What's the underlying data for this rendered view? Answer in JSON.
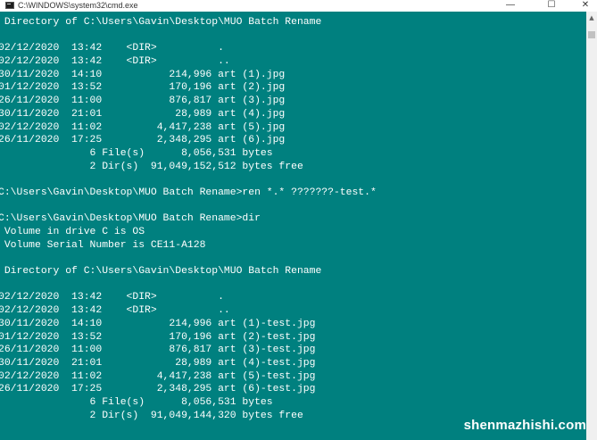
{
  "window": {
    "title": "C:\\WINDOWS\\system32\\cmd.exe",
    "minimize_glyph": "—",
    "maximize_glyph": "☐",
    "close_glyph": "✕"
  },
  "console": {
    "lines": [
      " Directory of C:\\Users\\Gavin\\Desktop\\MUO Batch Rename",
      "",
      "02/12/2020  13:42    <DIR>          .",
      "02/12/2020  13:42    <DIR>          ..",
      "30/11/2020  14:10           214,996 art (1).jpg",
      "01/12/2020  13:52           170,196 art (2).jpg",
      "26/11/2020  11:00           876,817 art (3).jpg",
      "30/11/2020  21:01            28,989 art (4).jpg",
      "02/12/2020  11:02         4,417,238 art (5).jpg",
      "26/11/2020  17:25         2,348,295 art (6).jpg",
      "               6 File(s)      8,056,531 bytes",
      "               2 Dir(s)  91,049,152,512 bytes free",
      "",
      "C:\\Users\\Gavin\\Desktop\\MUO Batch Rename>ren *.* ???????-test.*",
      "",
      "C:\\Users\\Gavin\\Desktop\\MUO Batch Rename>dir",
      " Volume in drive C is OS",
      " Volume Serial Number is CE11-A128",
      "",
      " Directory of C:\\Users\\Gavin\\Desktop\\MUO Batch Rename",
      "",
      "02/12/2020  13:42    <DIR>          .",
      "02/12/2020  13:42    <DIR>          ..",
      "30/11/2020  14:10           214,996 art (1)-test.jpg",
      "01/12/2020  13:52           170,196 art (2)-test.jpg",
      "26/11/2020  11:00           876,817 art (3)-test.jpg",
      "30/11/2020  21:01            28,989 art (4)-test.jpg",
      "02/12/2020  11:02         4,417,238 art (5)-test.jpg",
      "26/11/2020  17:25         2,348,295 art (6)-test.jpg",
      "               6 File(s)      8,056,531 bytes",
      "               2 Dir(s)  91,049,144,320 bytes free"
    ]
  },
  "scrollbar": {
    "up_arrow_glyph": "▲"
  },
  "watermark": {
    "text": "shenmazhishi.com"
  },
  "colors": {
    "console_background": "#00807f",
    "console_text": "#ffffff",
    "titlebar_background": "#ffffff"
  }
}
